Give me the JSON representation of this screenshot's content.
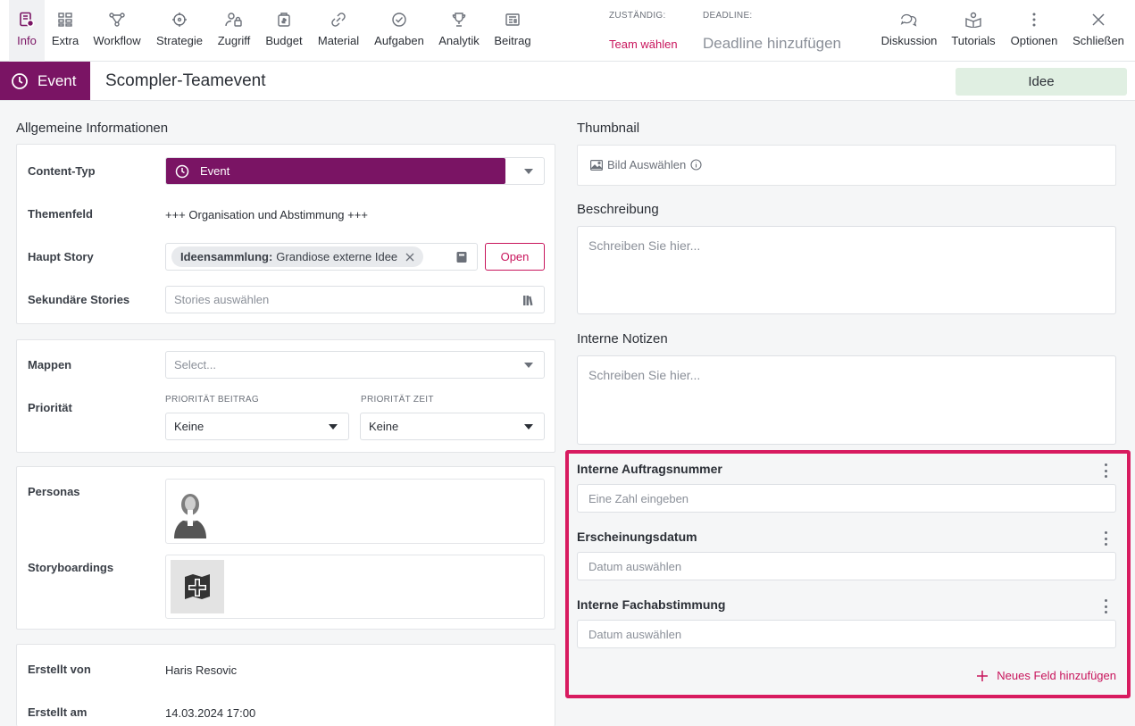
{
  "nav": {
    "items": [
      {
        "label": "Info",
        "icon": "info-doc-icon"
      },
      {
        "label": "Extra",
        "icon": "grid-icon"
      },
      {
        "label": "Workflow",
        "icon": "workflow-icon"
      },
      {
        "label": "Strategie",
        "icon": "target-icon"
      },
      {
        "label": "Zugriff",
        "icon": "user-lock-icon"
      },
      {
        "label": "Budget",
        "icon": "budget-icon"
      },
      {
        "label": "Material",
        "icon": "link-icon"
      },
      {
        "label": "Aufgaben",
        "icon": "check-circle-icon"
      },
      {
        "label": "Analytik",
        "icon": "trophy-icon"
      },
      {
        "label": "Beitrag",
        "icon": "newspaper-icon"
      }
    ],
    "right_items": [
      {
        "label": "Diskussion",
        "icon": "chat-icon"
      },
      {
        "label": "Tutorials",
        "icon": "tutorial-icon"
      },
      {
        "label": "Optionen",
        "icon": "more-vertical-icon"
      },
      {
        "label": "Schließen",
        "icon": "close-icon"
      }
    ]
  },
  "assignment": {
    "label": "ZUSTÄNDIG:",
    "value": "Team wählen"
  },
  "deadline": {
    "label": "DEADLINE:",
    "value": "Deadline hinzufügen"
  },
  "title_bar": {
    "type_label": "Event",
    "title": "Scompler-Teamevent",
    "status": "Idee"
  },
  "general": {
    "section_title": "Allgemeine Informationen",
    "content_type_label": "Content-Typ",
    "content_type_value": "Event",
    "topic_label": "Themenfeld",
    "topic_value": "+++ Organisation und Abstimmung +++",
    "main_story_label": "Haupt Story",
    "main_story_tag_bold": "Ideensammlung:",
    "main_story_tag_text": "Grandiose externe Idee",
    "open_button": "Open",
    "secondary_label": "Sekundäre Stories",
    "secondary_placeholder": "Stories auswählen"
  },
  "classification": {
    "folders_label": "Mappen",
    "folders_placeholder": "Select...",
    "priority_label": "Priorität",
    "priority_post_label": "PRIORITÄT BEITRAG",
    "priority_post_value": "Keine",
    "priority_time_label": "PRIORITÄT ZEIT",
    "priority_time_value": "Keine"
  },
  "people": {
    "personas_label": "Personas",
    "storyboards_label": "Storyboardings"
  },
  "created": {
    "by_label": "Erstellt von",
    "by_value": "Haris Resovic",
    "at_label": "Erstellt am",
    "at_value": "14.03.2024 17:00"
  },
  "right": {
    "thumbnail_label": "Thumbnail",
    "thumbnail_button": "Bild Auswählen",
    "description_label": "Beschreibung",
    "description_placeholder": "Schreiben Sie hier...",
    "notes_label": "Interne Notizen",
    "notes_placeholder": "Schreiben Sie hier..."
  },
  "custom_fields": {
    "fields": [
      {
        "label": "Interne Auftragsnummer",
        "placeholder": "Eine Zahl eingeben"
      },
      {
        "label": "Erscheinungsdatum",
        "placeholder": "Datum auswählen"
      },
      {
        "label": "Interne Fachabstimmung",
        "placeholder": "Datum auswählen"
      }
    ],
    "add_label": "Neues Feld hinzufügen"
  },
  "colors": {
    "brand": "#7a1464",
    "accent": "#c8155c",
    "highlight": "#d81b60",
    "status_bg": "#e0efe2"
  }
}
